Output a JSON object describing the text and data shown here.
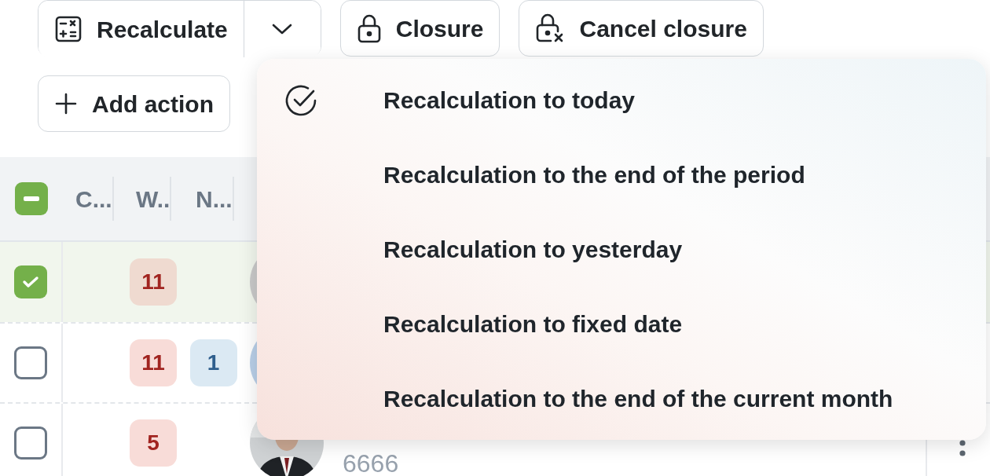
{
  "toolbar": {
    "buttons": [
      {
        "label": "Recalculate",
        "kind": "split"
      },
      {
        "label": "Closure",
        "kind": "lock"
      },
      {
        "label": "Cancel closure",
        "kind": "cancel-lock"
      }
    ],
    "add_action": "Add action"
  },
  "table": {
    "select_all": {
      "indeterminate": true
    },
    "columns": [
      "C...",
      "W..",
      "N..."
    ],
    "rows": [
      {
        "selected": true,
        "checked": true,
        "badges": [
          {
            "text": "11",
            "kind": "danger"
          }
        ],
        "avatar": {
          "kind": "circle",
          "color": "#c9c9c9"
        }
      },
      {
        "selected": false,
        "checked": false,
        "badges": [
          {
            "text": "11",
            "kind": "danger"
          },
          {
            "text": "1",
            "kind": "info"
          }
        ],
        "avatar": {
          "kind": "circle",
          "color": "#b9cfe8"
        }
      },
      {
        "selected": false,
        "checked": false,
        "badges": [
          {
            "text": "5",
            "kind": "danger"
          }
        ],
        "avatar": {
          "kind": "picture"
        },
        "subtitle": "6666"
      }
    ]
  },
  "dropdown": {
    "items": [
      {
        "label": "Recalculation to today",
        "selected": true
      },
      {
        "label": "Recalculation to the end of the period",
        "selected": false
      },
      {
        "label": "Recalculation to yesterday",
        "selected": false
      },
      {
        "label": "Recalculation to fixed date",
        "selected": false
      },
      {
        "label": "Recalculation to the end of the current month",
        "selected": false
      }
    ]
  }
}
